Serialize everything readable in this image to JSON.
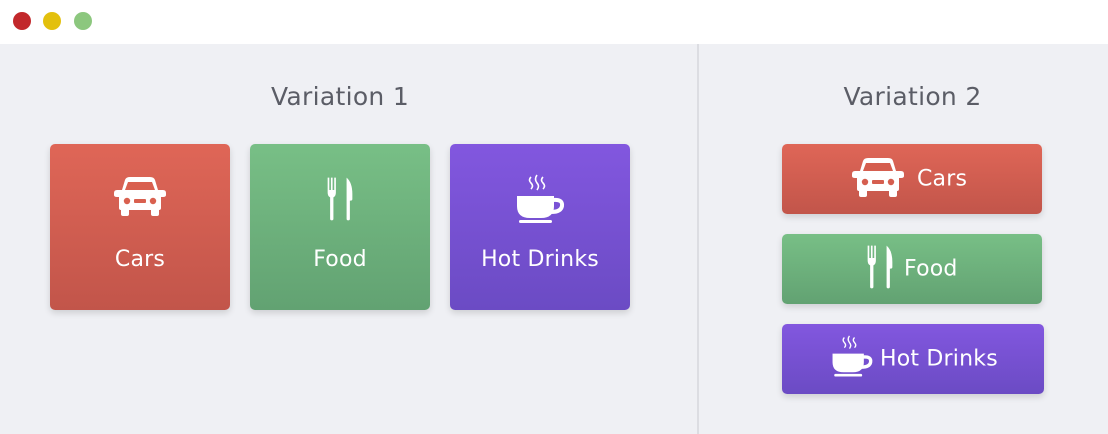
{
  "window": {
    "controls": [
      {
        "name": "close",
        "color": "#c2282b"
      },
      {
        "name": "minimize",
        "color": "#e3c00d"
      },
      {
        "name": "zoom",
        "color": "#8cc77e"
      }
    ]
  },
  "variation1": {
    "heading": "Variation 1",
    "cards": [
      {
        "label": "Cars",
        "icon": "car-icon"
      },
      {
        "label": "Food",
        "icon": "fork-knife-icon"
      },
      {
        "label": "Hot Drinks",
        "icon": "coffee-cup-icon"
      }
    ]
  },
  "variation2": {
    "heading": "Variation 2",
    "buttons": [
      {
        "label": "Cars",
        "icon": "car-icon"
      },
      {
        "label": "Food",
        "icon": "fork-knife-icon"
      },
      {
        "label": "Hot Drinks",
        "icon": "coffee-cup-icon"
      }
    ]
  },
  "colors": {
    "cars": "#d9604f",
    "food": "#6fb47f",
    "hot_drinks": "#7652d4",
    "background": "#eff0f4",
    "heading_text": "#5b5d66"
  }
}
